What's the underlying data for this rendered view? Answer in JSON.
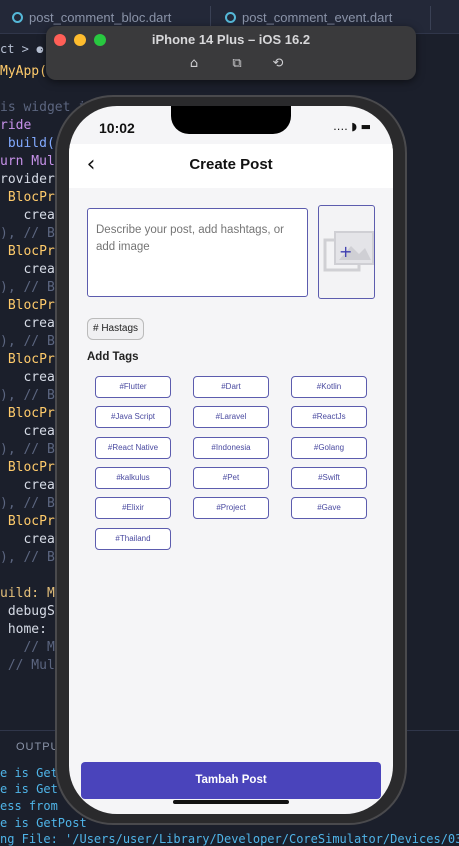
{
  "editor": {
    "tabs": [
      "post_comment_bloc.dart",
      "post_comment_event.dart"
    ],
    "breadcrumb": "ct > ⚈ MyApp(",
    "code_lines": [
      {
        "text": "MyApp(",
        "cls": "ty"
      },
      {
        "text": "",
        "cls": ""
      },
      {
        "text": "is widget i",
        "cls": "cm"
      },
      {
        "text": "ride",
        "cls": "kw"
      },
      {
        "text": " build(",
        "cls": "fn"
      },
      {
        "text": "urn Mult",
        "cls": "kw"
      },
      {
        "text": "roviders",
        "cls": ""
      },
      {
        "text": " BlocPro",
        "cls": "ty"
      },
      {
        "text": "   creat",
        "cls": ""
      },
      {
        "text": "), // B",
        "cls": "cm"
      },
      {
        "text": " BlocPro",
        "cls": "ty"
      },
      {
        "text": "   creat",
        "cls": ""
      },
      {
        "text": "), // B",
        "cls": "cm"
      },
      {
        "text": " BlocPro",
        "cls": "ty"
      },
      {
        "text": "   creat",
        "cls": ""
      },
      {
        "text": "), // B",
        "cls": "cm"
      },
      {
        "text": " BlocPro",
        "cls": "ty"
      },
      {
        "text": "   creat",
        "cls": ""
      },
      {
        "text": "), // B",
        "cls": "cm"
      },
      {
        "text": " BlocPro",
        "cls": "ty"
      },
      {
        "text": "   creat",
        "cls": ""
      },
      {
        "text": "), // B",
        "cls": "cm"
      },
      {
        "text": " BlocPro",
        "cls": "ty"
      },
      {
        "text": "   creat",
        "cls": ""
      },
      {
        "text": "), // B",
        "cls": "cm"
      },
      {
        "text": " BlocPro",
        "cls": "ty"
      },
      {
        "text": "   creat",
        "cls": ""
      },
      {
        "text": "), // B",
        "cls": "cm"
      },
      {
        "text": "",
        "cls": ""
      },
      {
        "text": "uild: Ma",
        "cls": "pn"
      },
      {
        "text": " debugSh",
        "cls": ""
      },
      {
        "text": " home: B",
        "cls": ""
      },
      {
        "text": "   // Mat",
        "cls": "cm"
      },
      {
        "text": " // Multi",
        "cls": "cm"
      }
    ],
    "output_label": "OUTPUT",
    "terminal_lines": [
      "e is Get",
      "e is Get",
      "ess from",
      "e is GetPost",
      "ng File: '/Users/user/Library/Developer/CoreSimulator/Devices/03"
    ]
  },
  "simulator": {
    "title": "iPhone 14 Plus – iOS 16.2",
    "icons": [
      "home-icon",
      "screenshot-icon",
      "rotate-icon"
    ]
  },
  "phone": {
    "time": "10:02",
    "status": "․․․․ ◗ ▬",
    "app": {
      "title": "Create Post",
      "description_placeholder": "Describe your post, add hashtags, or add image",
      "add_image_symbol": "+",
      "hashtag_chip": "# Hastags",
      "add_tags_label": "Add Tags",
      "tags": [
        "#Flutter",
        "#Dart",
        "#Kotlin",
        "#Java Script",
        "#Laravel",
        "#ReactJs",
        "#React Native",
        "#Indonesia",
        "#Golang",
        "#kalkulus",
        "#Pet",
        "#Swift",
        "#Elixir",
        "#Project",
        "#Gave",
        "#Thailand"
      ],
      "submit_label": "Tambah Post"
    }
  },
  "colors": {
    "accent": "#4a44bb",
    "border": "#5c5cae",
    "editor_bg": "#1b1f2b"
  }
}
